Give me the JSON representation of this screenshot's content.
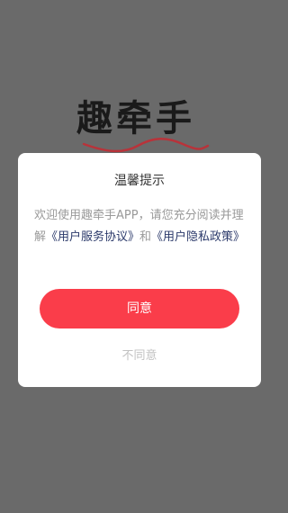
{
  "app": {
    "logo_text": "趣牵手"
  },
  "dialog": {
    "title": "温馨提示",
    "body_prefix": "欢迎使用趣牵手APP，请您充分阅读并理解",
    "user_agreement_link": "《用户服务协议》",
    "connector": "和",
    "privacy_link": "《用户隐私政策》",
    "agree_label": "同意",
    "disagree_label": "不同意"
  },
  "colors": {
    "overlay": "#6a6a6a",
    "agree_button": "#fa3d4a",
    "link": "#2c3a6b",
    "logo_swash": "#b8333a"
  }
}
